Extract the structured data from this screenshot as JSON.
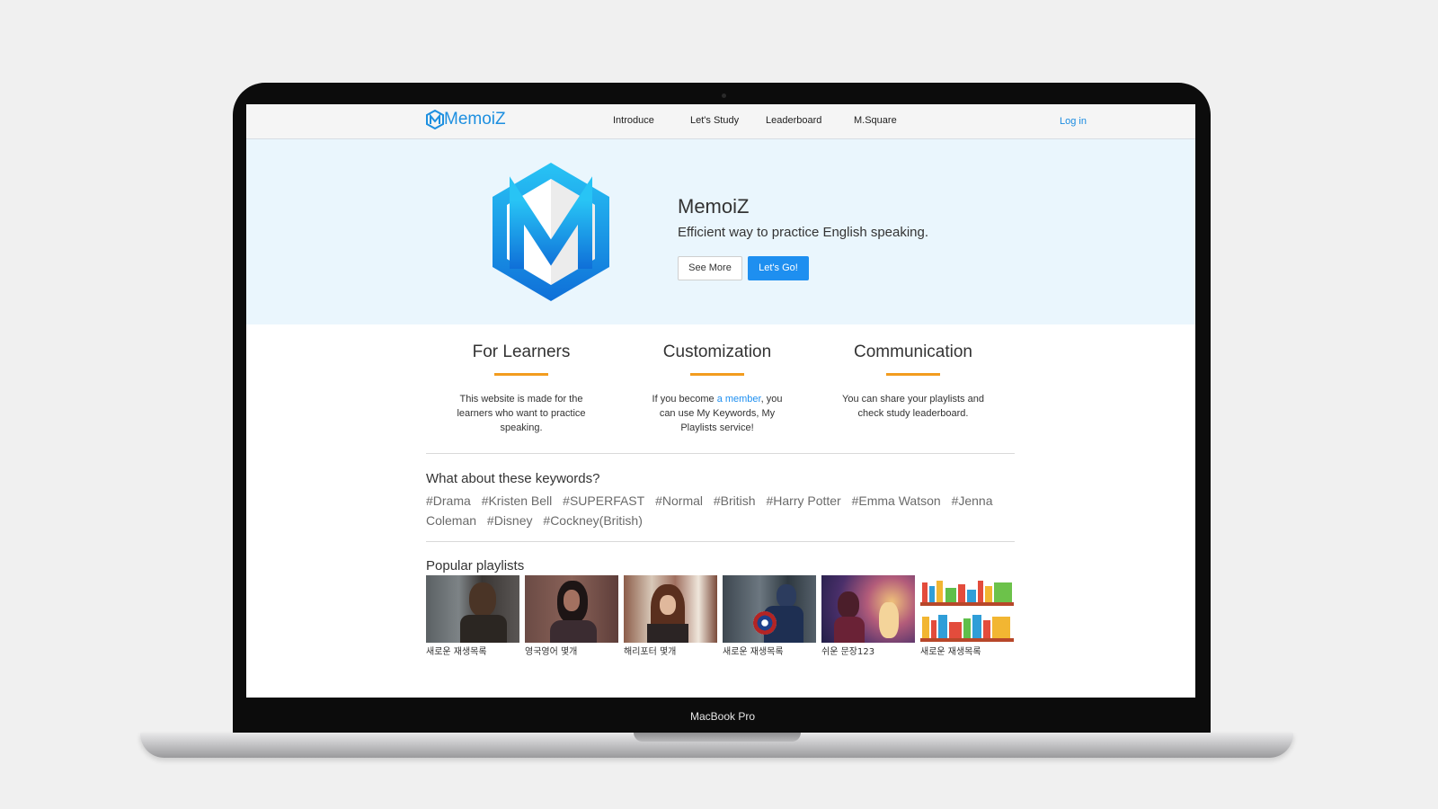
{
  "device_label": "MacBook Pro",
  "nav": {
    "brand": "MemoiZ",
    "items": [
      "Introduce",
      "Let's Study",
      "Leaderboard",
      "M.Square"
    ],
    "login": "Log in"
  },
  "hero": {
    "title": "MemoiZ",
    "subtitle": "Efficient way to practice English speaking.",
    "see_more": "See More",
    "lets_go": "Let's Go!"
  },
  "features": [
    {
      "title": "For Learners",
      "text": "This website is made for the learners who want to practice speaking."
    },
    {
      "title": "Customization",
      "text_before": "If you become ",
      "link": "a member",
      "text_after": ", you can use My Keywords, My Playlists service!"
    },
    {
      "title": "Communication",
      "text": "You can share your playlists and check study leaderboard."
    }
  ],
  "keywords": {
    "title": "What about these keywords?",
    "items": [
      "#Drama",
      "#Kristen Bell",
      "#SUPERFAST",
      "#Normal",
      "#British",
      "#Harry Potter",
      "#Emma Watson",
      "#Jenna Coleman",
      "#Disney",
      "#Cockney(British)"
    ]
  },
  "playlists": {
    "title": "Popular playlists",
    "items": [
      {
        "caption": "새로운 재생목록",
        "image": "man-portrait"
      },
      {
        "caption": "영국영어 몇개",
        "image": "woman-portrait"
      },
      {
        "caption": "해리포터 몇개",
        "image": "girl-portrait"
      },
      {
        "caption": "새로운 재생목록",
        "image": "hero-shield"
      },
      {
        "caption": "쉬운 문장123",
        "image": "lantern-scene"
      },
      {
        "caption": "새로운 재생목록",
        "image": "bookshelf"
      }
    ]
  },
  "colors": {
    "accent": "#1e8ff0",
    "hero_bg": "#eaf6fd",
    "feature_bar": "#f29c1f"
  }
}
